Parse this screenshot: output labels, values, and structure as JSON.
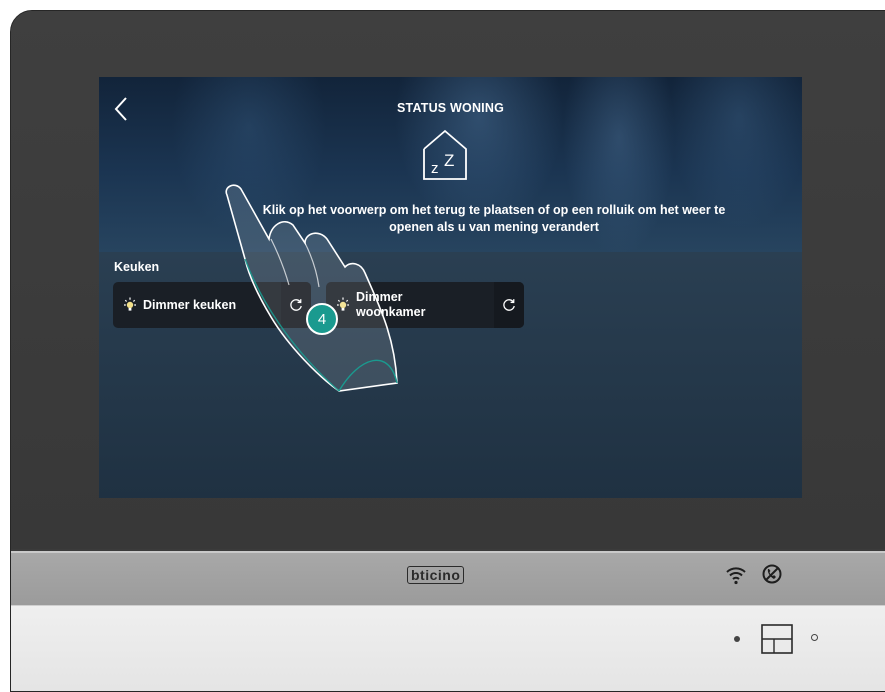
{
  "screen": {
    "title": "STATUS WONING",
    "status_icon": "house-sleep-icon",
    "instruction": "Klik op het voorwerp om het terug te plaatsen of op een rolluik om het weer te openen als u van mening verandert",
    "room": {
      "name": "Keuken",
      "devices": [
        {
          "label": "Dimmer keuken",
          "icon": "bulb-icon",
          "action_icon": "refresh-icon"
        },
        {
          "label": "Dimmer woonkamer",
          "icon": "bulb-icon",
          "action_icon": "refresh-icon"
        }
      ]
    }
  },
  "device": {
    "brand": "bticino",
    "status_icons": [
      "wifi-icon",
      "no-call-icon"
    ]
  },
  "annotation": {
    "step": "4"
  },
  "colors": {
    "badge": "#1a9a8f",
    "screen_bg": "#1f3142",
    "card_bg": "#1a1f26",
    "bezel": "#3b3b3b"
  }
}
